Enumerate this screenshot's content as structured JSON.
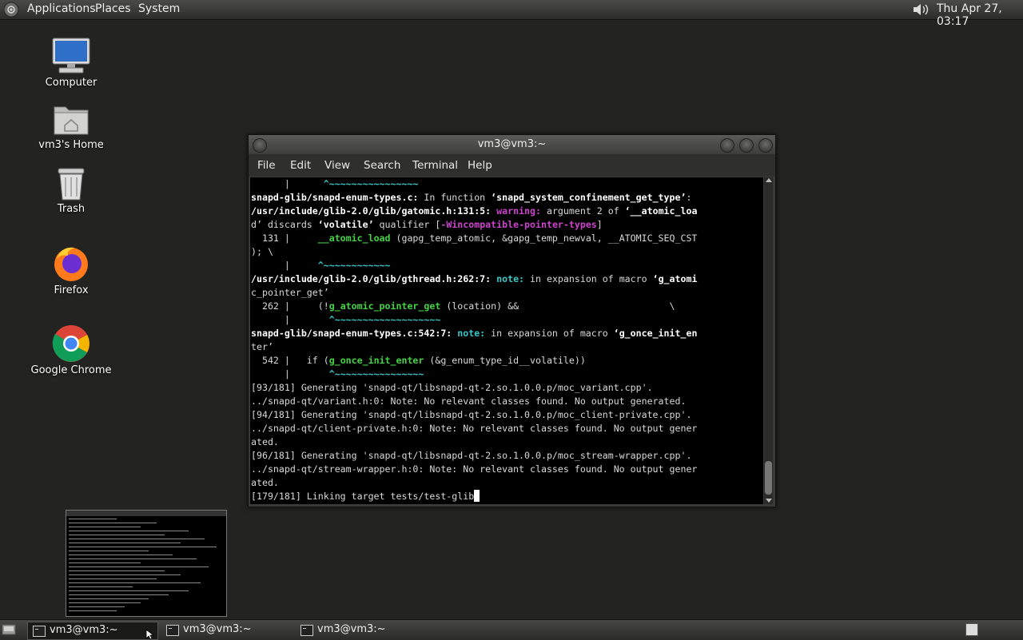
{
  "top_panel": {
    "menus": [
      "Applications",
      "Places",
      "System"
    ],
    "clock": "Thu Apr 27, 03:17",
    "icons": [
      "distro-logo-icon",
      "volume-icon"
    ]
  },
  "desktop": {
    "icons": [
      {
        "label": "Computer",
        "icon": "computer-icon"
      },
      {
        "label": "vm3's Home",
        "icon": "home-folder-icon"
      },
      {
        "label": "Trash",
        "icon": "trash-icon"
      },
      {
        "label": "Firefox",
        "icon": "firefox-icon"
      },
      {
        "label": "Google Chrome",
        "icon": "chrome-icon"
      }
    ]
  },
  "terminal": {
    "title": "vm3@vm3:~",
    "menu": [
      "File",
      "Edit",
      "View",
      "Search",
      "Terminal",
      "Help"
    ],
    "lines": [
      "      |      ^~~~~~~~~~~~~~~~~",
      "snapd-glib/snapd-enum-types.c: In function ‘snapd_system_confinement_get_type’:",
      "/usr/include/glib-2.0/glib/gatomic.h:131:5: warning: argument 2 of ‘__atomic_loa",
      "d’ discards ‘volatile’ qualifier [-Wincompatible-pointer-types]",
      "  131 |     __atomic_load (gapg_temp_atomic, &gapg_temp_newval, __ATOMIC_SEQ_CST",
      "); \\",
      "      |     ^~~~~~~~~~~~~",
      "/usr/include/glib-2.0/glib/gthread.h:262:7: note: in expansion of macro ‘g_atomi",
      "c_pointer_get’",
      "  262 |     (!g_atomic_pointer_get (location) &&                           \\",
      "      |       ^~~~~~~~~~~~~~~~~~~~",
      "snapd-glib/snapd-enum-types.c:542:7: note: in expansion of macro ‘g_once_init_en",
      "ter’",
      "  542 |   if (g_once_init_enter (&g_enum_type_id__volatile))",
      "      |       ^~~~~~~~~~~~~~~~~",
      "[93/181] Generating 'snapd-qt/libsnapd-qt-2.so.1.0.0.p/moc_variant.cpp'.",
      "../snapd-qt/variant.h:0: Note: No relevant classes found. No output generated.",
      "[94/181] Generating 'snapd-qt/libsnapd-qt-2.so.1.0.0.p/moc_client-private.cpp'.",
      "../snapd-qt/client-private.h:0: Note: No relevant classes found. No output gener",
      "ated.",
      "[96/181] Generating 'snapd-qt/libsnapd-qt-2.so.1.0.0.p/moc_stream-wrapper.cpp'.",
      "../snapd-qt/stream-wrapper.h:0: Note: No relevant classes found. No output gener",
      "ated.",
      "[179/181] Linking target tests/test-glib"
    ]
  },
  "taskbar": {
    "tasks": [
      {
        "label": "vm3@vm3:~",
        "active": true
      },
      {
        "label": "vm3@vm3:~",
        "active": false
      },
      {
        "label": "vm3@vm3:~",
        "active": false
      }
    ]
  },
  "colors": {
    "panel": "#3b3b3a",
    "desktop": "#232322",
    "terminal_bg": "#000000",
    "note": "#38c8c8",
    "warning": "#cc44cc",
    "caret": "#44d444"
  }
}
